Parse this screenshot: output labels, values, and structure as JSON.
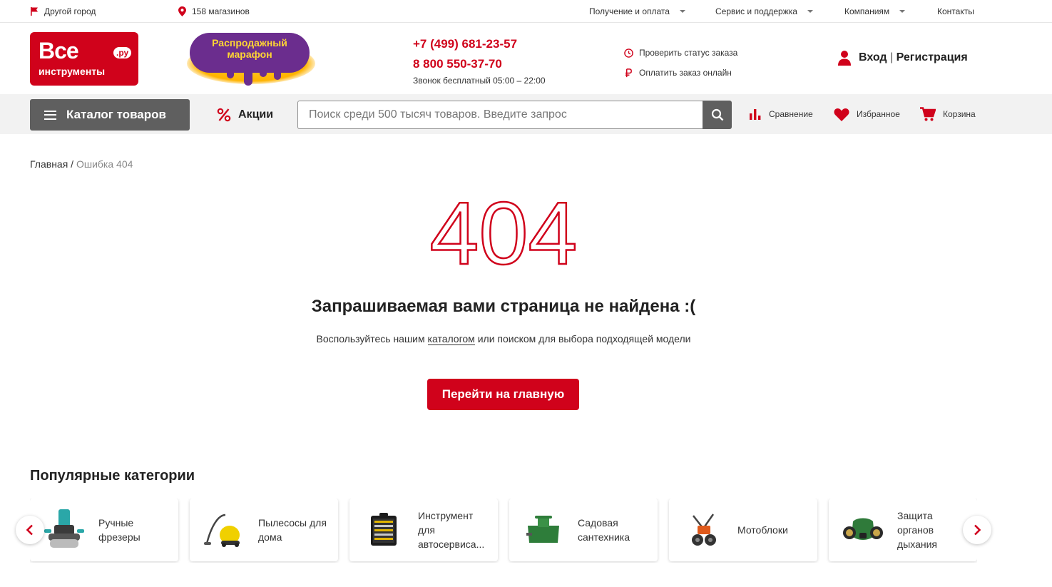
{
  "topbar": {
    "city": "Другой город",
    "stores": "158 магазинов",
    "menu": [
      "Получение и оплата",
      "Сервис и поддержка",
      "Компаниям",
      "Контакты"
    ]
  },
  "logo": {
    "line1": "Все",
    "line2": "инструменты",
    "suffix": ".ру"
  },
  "promo": {
    "text": "Распродажный марафон"
  },
  "contacts": {
    "phone1": "+7 (499) 681-23-57",
    "phone2": "8 800 550-37-70",
    "note": "Звонок бесплатный 05:00 – 22:00"
  },
  "header_links": {
    "status": "Проверить статус заказа",
    "pay": "Оплатить заказ онлайн"
  },
  "auth": {
    "login": "Вход",
    "sep": "|",
    "register": "Регистрация"
  },
  "nav": {
    "catalog": "Каталог товаров",
    "sales": "Акции",
    "search_placeholder": "Поиск среди 500 тысяч товаров. Введите запрос",
    "compare": "Сравнение",
    "favorites": "Избранное",
    "cart": "Корзина"
  },
  "breadcrumb": {
    "home": "Главная",
    "sep": " / ",
    "current": "Ошибка 404"
  },
  "error": {
    "code": "404",
    "title": "Запрашиваемая вами страница не найдена :(",
    "sub_before": "Воспользуйтесь нашим ",
    "sub_link": "каталогом",
    "sub_after": " или поиском для выбора подходящей модели",
    "button": "Перейти на главную"
  },
  "popular": {
    "title": "Популярные категории",
    "items": [
      {
        "label": "Ручные фрезеры",
        "icon": "router-tool-icon"
      },
      {
        "label": "Пылесосы для дома",
        "icon": "vacuum-cleaner-icon"
      },
      {
        "label": "Инструмент для автосервиса...",
        "icon": "tool-case-icon"
      },
      {
        "label": "Садовая сантехника",
        "icon": "septic-tank-icon"
      },
      {
        "label": "Мотоблоки",
        "icon": "motor-cultivator-icon"
      },
      {
        "label": "Защита органов дыхания",
        "icon": "respirator-icon"
      }
    ]
  },
  "colors": {
    "brand": "#d0021b",
    "dark_button": "#5f5f5f",
    "promo_purple": "#6b2d8e",
    "promo_yellow": "#ffd633"
  }
}
